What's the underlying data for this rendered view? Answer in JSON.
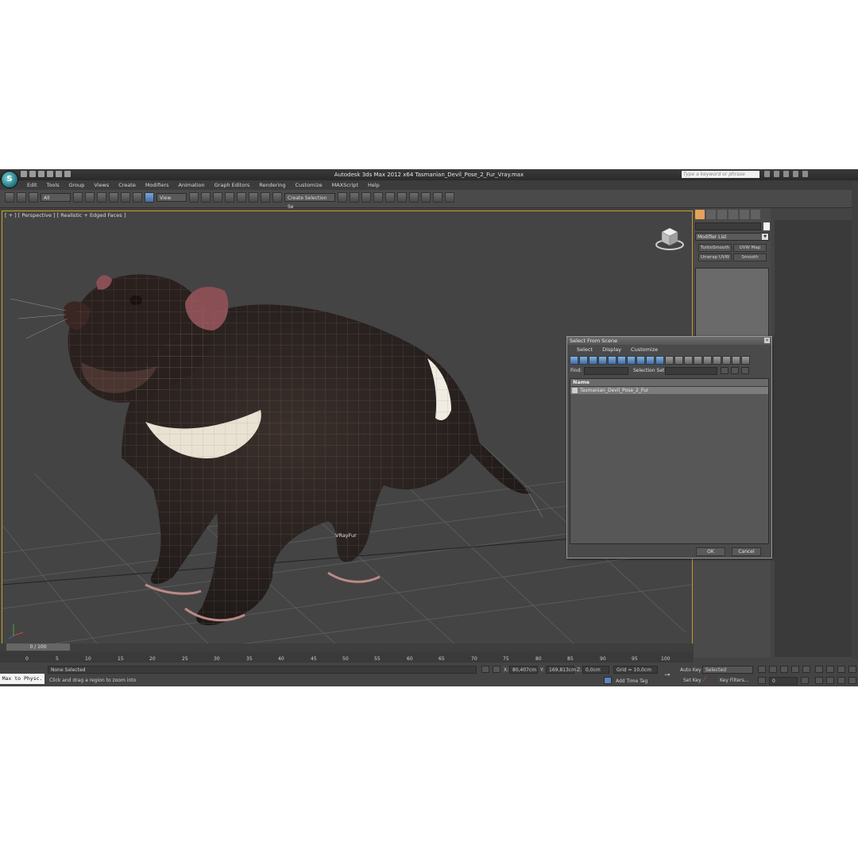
{
  "app": {
    "logo_text": "S",
    "title": "Autodesk 3ds Max  2012 x64      Tasmanian_Devil_Pose_2_Fur_Vray.max",
    "search_placeholder": "Type a keyword or phrase"
  },
  "menu": [
    "Edit",
    "Tools",
    "Group",
    "Views",
    "Create",
    "Modifiers",
    "Animation",
    "Graph Editors",
    "Rendering",
    "Customize",
    "MAXScript",
    "Help"
  ],
  "toolbar": {
    "filter": "All",
    "coord_system": "View",
    "selection_set": "Create Selection Se"
  },
  "viewport": {
    "label": "[ + ] [ Perspective ] [ Realistic + Edged Faces ]",
    "object_label": "VRayFur"
  },
  "command_panel": {
    "modifier_list": "Modifier List",
    "buttons": [
      "TurboSmooth",
      "UVW Map",
      "Unwrap UVW",
      "Smooth"
    ]
  },
  "dialog": {
    "title": "Select From Scene",
    "menu": [
      "Select",
      "Display",
      "Customize"
    ],
    "find_label": "Find:",
    "selection_set_label": "Selection Set:",
    "column_name": "Name",
    "items": [
      "Tasmanian_Devil_Pose_2_Fur"
    ],
    "ok": "OK",
    "cancel": "Cancel"
  },
  "timeline": {
    "frame": "0 / 100",
    "ticks": [
      "0",
      "5",
      "10",
      "15",
      "20",
      "25",
      "30",
      "35",
      "40",
      "45",
      "50",
      "55",
      "60",
      "65",
      "70",
      "75",
      "80",
      "85",
      "90",
      "95",
      "100"
    ]
  },
  "status": {
    "max_to_physc": "Max to Physc.",
    "selection": "None Selected",
    "prompt": "Click and drag a region to zoom into",
    "x_label": "X:",
    "x": "80,407cm",
    "y_label": "Y:",
    "y": "169,813cm",
    "z_label": "Z:",
    "z": "0,0cm",
    "grid": "Grid = 10,0cm",
    "add_time_tag": "Add Time Tag",
    "auto_key": "Auto Key",
    "auto_key_value": "Selected",
    "set_key": "Set Key",
    "key_filters": "Key Filters...",
    "current_frame": "0"
  },
  "colors": {
    "ui_bg": "#444444",
    "viewport_border": "#c8a024",
    "accent_blue": "#5a86c0"
  }
}
